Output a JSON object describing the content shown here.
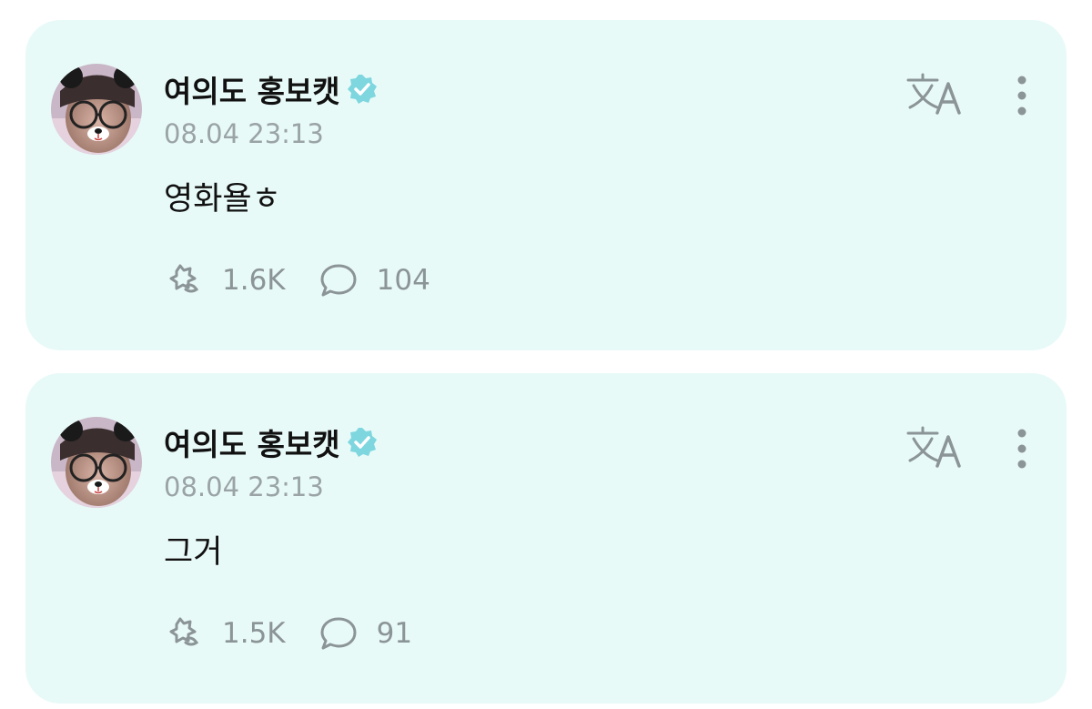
{
  "colors": {
    "card_background": "#e8faf8",
    "accent": "#7ed6df",
    "icon_gray": "#8b9497",
    "timestamp_gray": "#9aa3a6"
  },
  "posts": [
    {
      "author": "여의도 홍보캣",
      "verified": true,
      "timestamp": "08.04 23:13",
      "text": "영화욜ㅎ",
      "actions": {
        "likes": "1.6K",
        "comments": "104"
      },
      "icons": {
        "avatar": "avatar-bear-filter",
        "verified": "verified-badge-icon",
        "translate": "translate-icon",
        "more": "more-vertical-icon",
        "like": "heart-star-icon",
        "comment": "comment-bubble-icon"
      }
    },
    {
      "author": "여의도 홍보캣",
      "verified": true,
      "timestamp": "08.04 23:13",
      "text": "그거",
      "actions": {
        "likes": "1.5K",
        "comments": "91"
      },
      "icons": {
        "avatar": "avatar-bear-filter",
        "verified": "verified-badge-icon",
        "translate": "translate-icon",
        "more": "more-vertical-icon",
        "like": "heart-star-icon",
        "comment": "comment-bubble-icon"
      }
    }
  ]
}
